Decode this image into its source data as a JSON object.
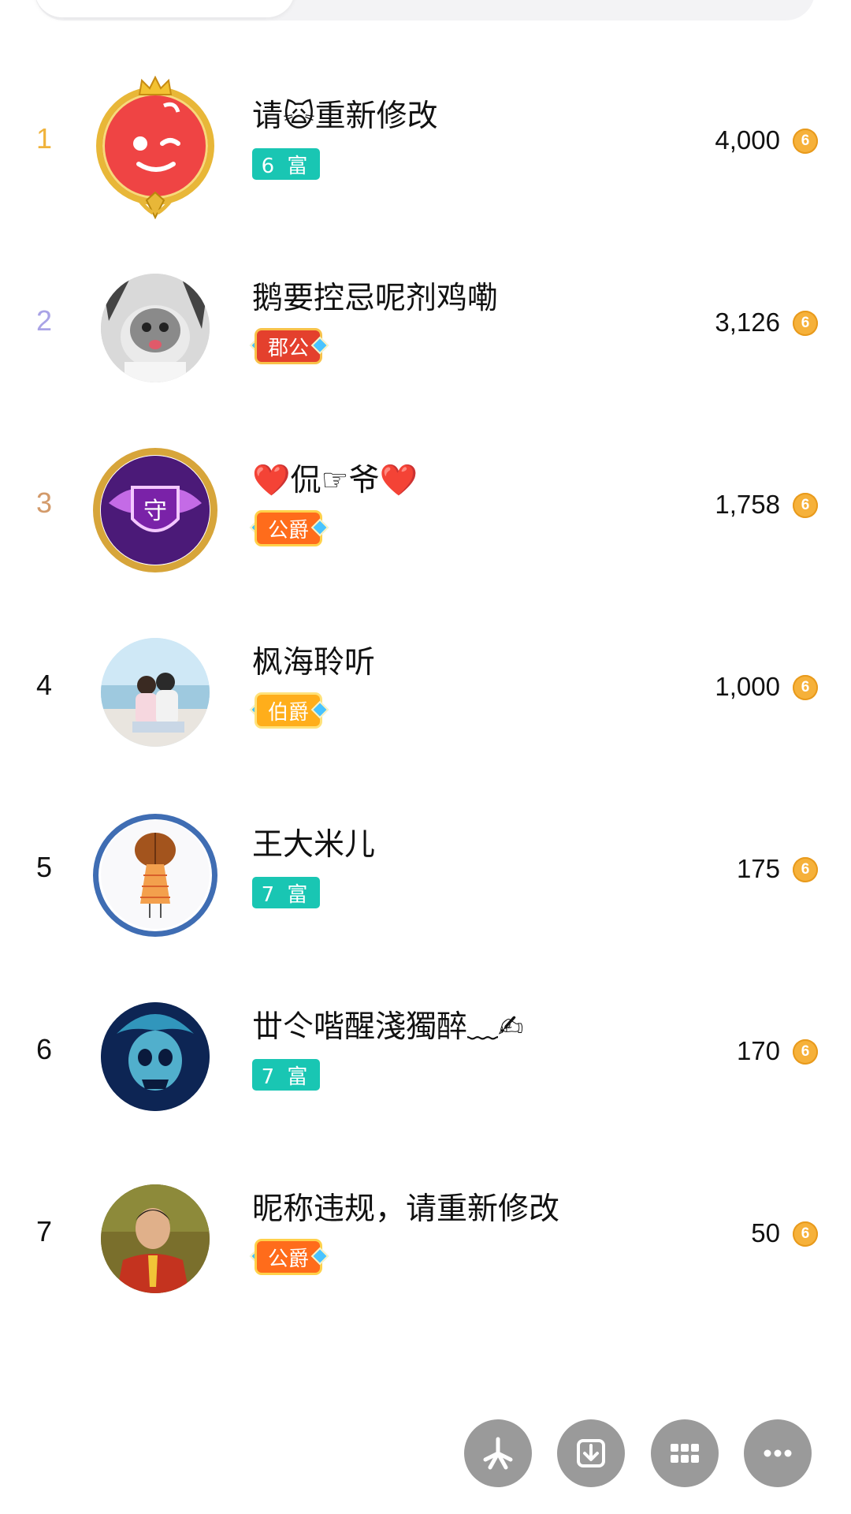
{
  "ranking": [
    {
      "rank": "1",
      "name": "请🙀重新修改",
      "badge": "6 富",
      "amount": "4,000",
      "rank_color": "#f0b33c",
      "badge_type": "teal",
      "avatar_icon": "red-mascot-icon"
    },
    {
      "rank": "2",
      "name": "鹅要控忌呢剂鸡嘞",
      "badge": "郡公",
      "amount": "3,126",
      "rank_color": "#a9a3e6",
      "badge_type": "red",
      "avatar_icon": "cat-photo-avatar"
    },
    {
      "rank": "3",
      "name": "❤️侃☞爷❤️",
      "badge": "公爵",
      "amount": "1,758",
      "rank_color": "#d39a6a",
      "badge_type": "orange",
      "avatar_icon": "guard-shield-icon"
    },
    {
      "rank": "4",
      "name": "枫海聆听",
      "badge": "伯爵",
      "amount": "1,000",
      "rank_color": "#111111",
      "badge_type": "amber",
      "avatar_icon": "couple-beach-avatar"
    },
    {
      "rank": "5",
      "name": "王大米儿",
      "badge": "7 富",
      "amount": "175",
      "rank_color": "#111111",
      "badge_type": "teal",
      "avatar_icon": "girl-drawing-avatar"
    },
    {
      "rank": "6",
      "name": "丗仒喈醒淺獨醉﹏✍",
      "badge": "7 富",
      "amount": "170",
      "rank_color": "#111111",
      "badge_type": "teal",
      "avatar_icon": "skull-avatar"
    },
    {
      "rank": "7",
      "name": "昵称违规，请重新修改",
      "badge": "公爵",
      "amount": "50",
      "rank_color": "#111111",
      "badge_type": "orange",
      "avatar_icon": "man-portrait-avatar"
    }
  ],
  "bottom_actions": [
    {
      "icon": "pinwheel-icon"
    },
    {
      "icon": "download-icon"
    },
    {
      "icon": "grid-icon"
    },
    {
      "icon": "more-icon"
    }
  ]
}
